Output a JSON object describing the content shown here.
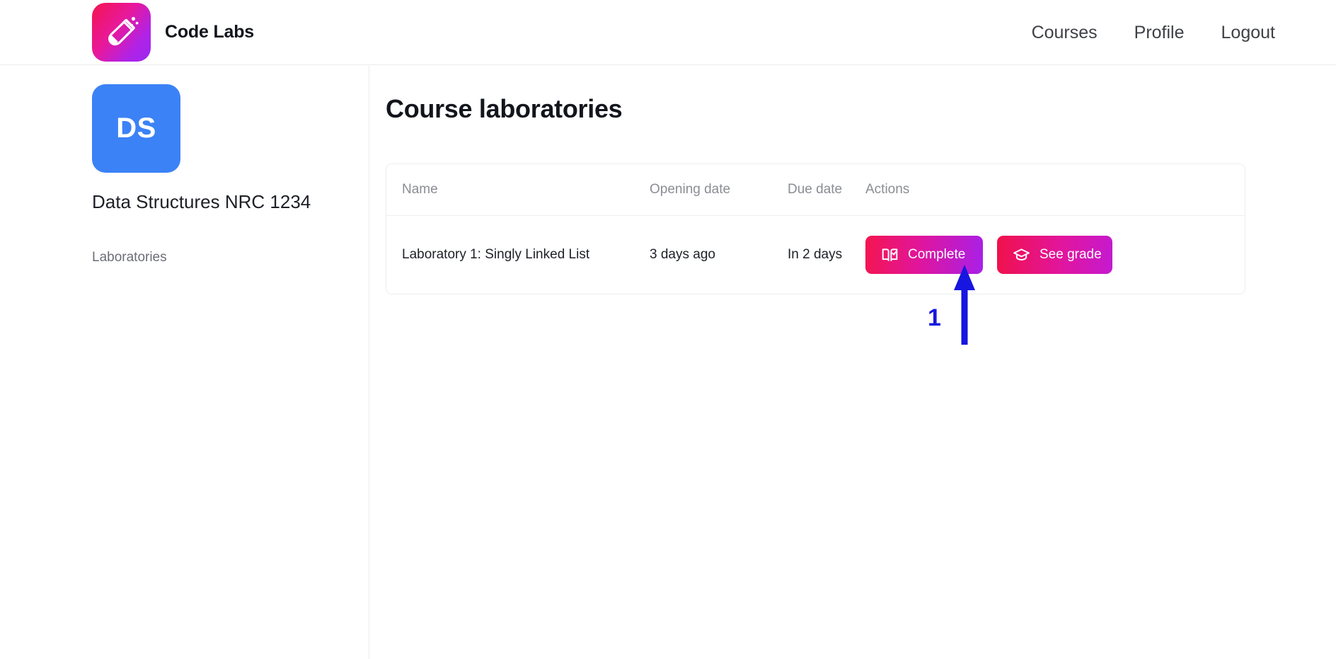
{
  "header": {
    "brand_name": "Code Labs",
    "logo_icon": "test-tube-icon",
    "nav": [
      {
        "label": "Courses",
        "name": "nav-link-courses"
      },
      {
        "label": "Profile",
        "name": "nav-link-profile"
      },
      {
        "label": "Logout",
        "name": "nav-link-logout"
      }
    ]
  },
  "sidebar": {
    "course_initials": "DS",
    "course_title": "Data Structures NRC 1234",
    "items": [
      {
        "label": "Laboratories"
      }
    ]
  },
  "main": {
    "page_title": "Course laboratories",
    "table": {
      "columns": [
        "Name",
        "Opening date",
        "Due date",
        "Actions"
      ],
      "rows": [
        {
          "name": "Laboratory 1: Singly Linked List",
          "opening_date": "3 days ago",
          "due_date": "In 2 days",
          "actions": [
            {
              "label": "Complete",
              "icon": "book-check-icon"
            },
            {
              "label": "See grade",
              "icon": "graduation-cap-icon"
            }
          ]
        }
      ]
    }
  },
  "annotation": {
    "step_number": "1",
    "arrow_color": "#1616e0",
    "points_at": "Complete"
  },
  "colors": {
    "brand_gradient_start": "#f4154f",
    "brand_gradient_end": "#9b27f0",
    "course_avatar": "#3b82f6",
    "button_gradient_start": "#f4154f",
    "button_gradient_end": "#a820e8",
    "annotation_blue": "#1616e0",
    "text_primary": "#12151c",
    "text_muted": "#8a8d94",
    "border": "#eceef0"
  }
}
